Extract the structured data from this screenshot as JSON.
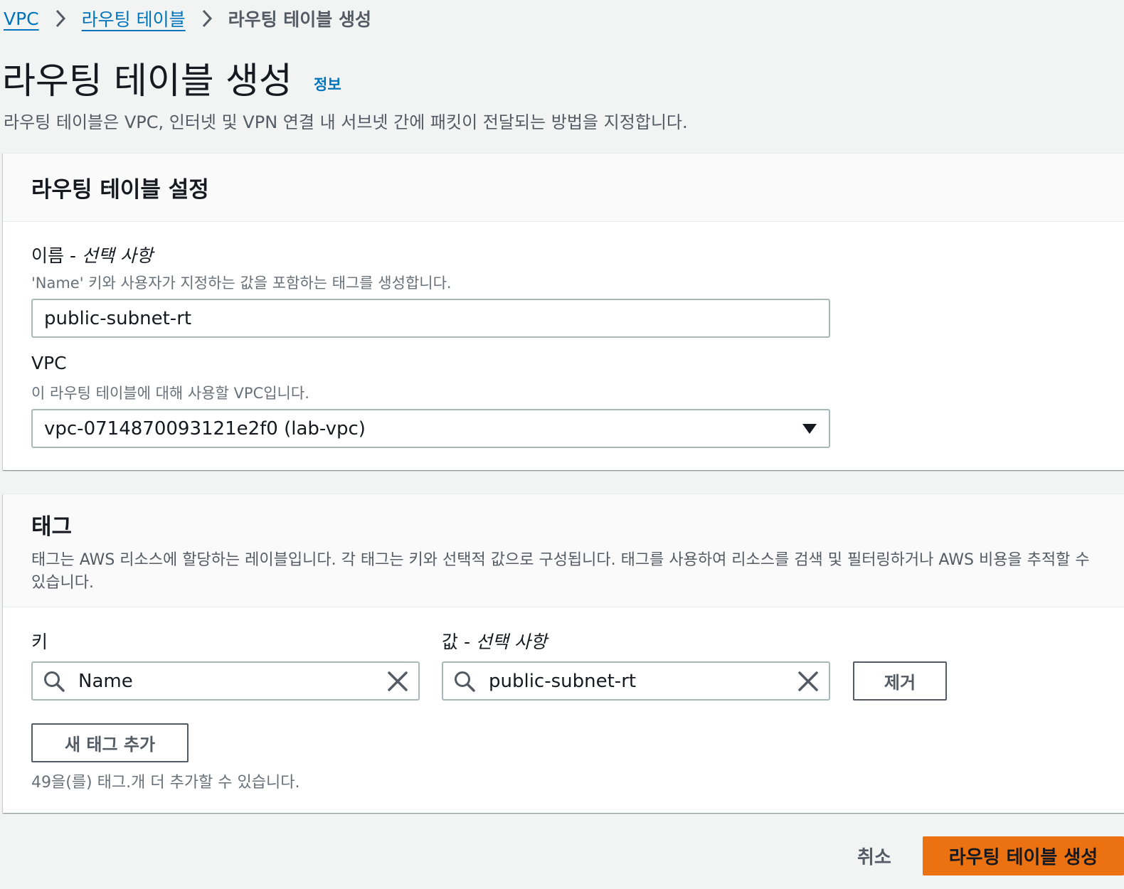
{
  "breadcrumb": {
    "items": [
      "VPC",
      "라우팅 테이블"
    ],
    "current": "라우팅 테이블 생성"
  },
  "header": {
    "title": "라우팅 테이블 생성",
    "info": "정보",
    "description": "라우팅 테이블은 VPC, 인터넷 및 VPN 연결 내 서브넷 간에 패킷이 전달되는 방법을 지정합니다."
  },
  "settings": {
    "title": "라우팅 테이블 설정",
    "name_label": "이름 - ",
    "name_optional": "선택 사항",
    "name_hint": "'Name' 키와 사용자가 지정하는 값을 포함하는 태그를 생성합니다.",
    "name_value": "public-subnet-rt",
    "vpc_label": "VPC",
    "vpc_hint": "이 라우팅 테이블에 대해 사용할 VPC입니다.",
    "vpc_value": "vpc-0714870093121e2f0 (lab-vpc)"
  },
  "tags": {
    "title": "태그",
    "description": "태그는 AWS 리소스에 할당하는 레이블입니다. 각 태그는 키와 선택적 값으로 구성됩니다. 태그를 사용하여 리소스를 검색 및 필터링하거나 AWS 비용을 추적할 수 있습니다.",
    "key_label": "키",
    "value_label": "값 - ",
    "value_optional": "선택 사항",
    "key_value": "Name",
    "value_value": "public-subnet-rt",
    "remove_label": "제거",
    "add_label": "새 태그 추가",
    "remaining": "49을(를) 태그.개 더 추가할 수 있습니다."
  },
  "footer": {
    "cancel_label": "취소",
    "create_label": "라우팅 테이블 생성"
  },
  "colors": {
    "accent": "#0073bb",
    "primary_button": "#ec7211"
  }
}
